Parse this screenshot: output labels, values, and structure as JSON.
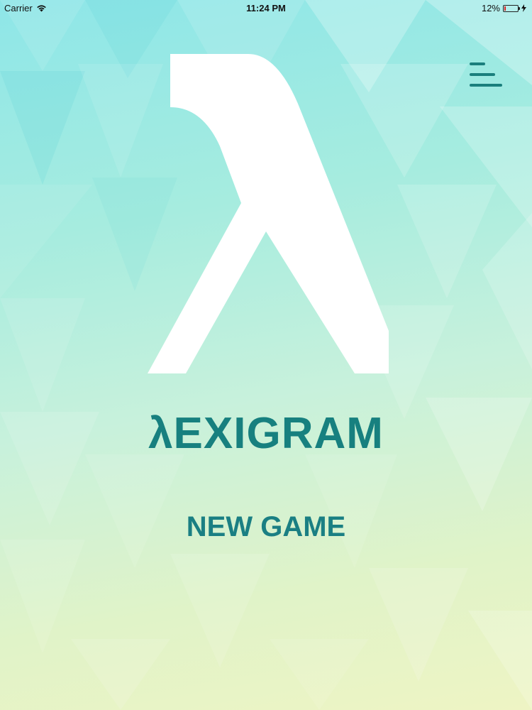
{
  "status_bar": {
    "carrier": "Carrier",
    "time": "11:24 PM",
    "battery_percent_label": "12%",
    "battery_level": 0.12
  },
  "header": {
    "menu_icon": "hamburger-menu-icon"
  },
  "logo": {
    "symbol_icon": "lambda-icon",
    "wordmark": "λEXIGRAM"
  },
  "main": {
    "new_game_label": "NEW GAME"
  },
  "colors": {
    "accent": "#17807f",
    "logo_symbol": "#ffffff"
  }
}
